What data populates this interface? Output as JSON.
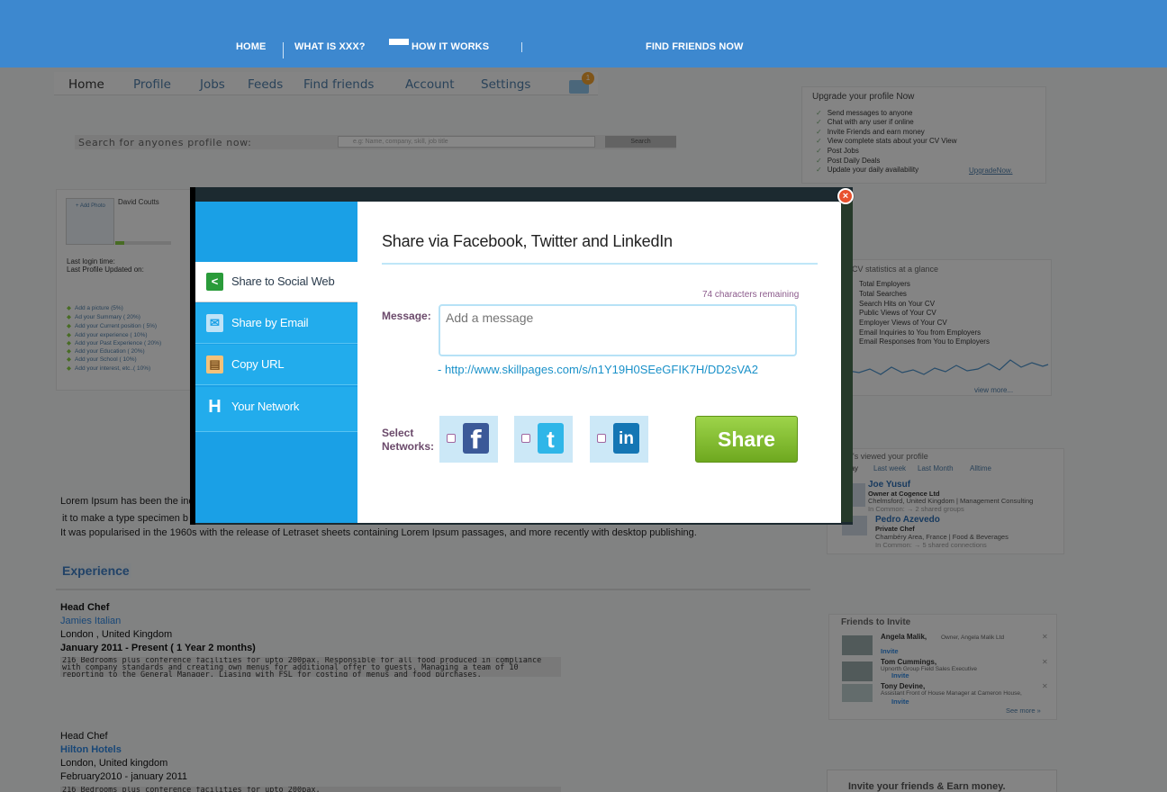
{
  "topnav": {
    "home": "HOME",
    "what_is": "WHAT IS XXX?",
    "how_it_works": "HOW IT WORKS",
    "find_friends": "FIND FRIENDS NOW"
  },
  "subnav": {
    "items": [
      "Home",
      "Profile",
      "Jobs",
      "Feeds",
      "Find friends",
      "Account",
      "Settings"
    ],
    "mail_badge": "1"
  },
  "search": {
    "label": "Search for anyones profile now:",
    "placeholder": "e.g: Name, company, skill, job title",
    "button": "Search"
  },
  "upgrade": {
    "title": "Upgrade your profile Now",
    "items": [
      "Send messages to anyone",
      "Chat with any user if online",
      "Invite Friends and earn money",
      "View complete stats about your CV View",
      "Post Jobs",
      "Post Daily Deals",
      "Update your daily availability"
    ],
    "link": "UpgradeNow."
  },
  "profile": {
    "add_photo": "+ Add Photo",
    "name": "David Coutts",
    "last_login": "Last login time:",
    "last_updated": "Last Profile Updated on:",
    "suggestions": [
      "Add a picture (5%)",
      "Ad your Summary ( 20%)",
      "Add your Current position ( 5%)",
      "Add your experience ( 10%)",
      "Add your Past Experience ( 20%)",
      "Add your Education ( 20%)",
      "Add your School ( 10%)",
      "Add your interest, etc..( 10%)"
    ]
  },
  "stats": {
    "title": "CV statistics at a glance",
    "items": [
      "Total Employers",
      "Total Searches",
      "Search Hits on Your CV",
      "Public Views of Your CV",
      "Employer Views of Your CV",
      "Email Inquiries to You from Employers",
      "Email Responses from You to Employers"
    ],
    "view_more": "view more..."
  },
  "viewed": {
    "title": "o's viewed your profile",
    "tabs": [
      "day",
      "Last week",
      "Last Month",
      "Alltime"
    ],
    "viewers": [
      {
        "name": "Joe Yusuf",
        "role": "Owner at Cogence Ltd",
        "loc": "Chelmsford, United Kingdom | Management Consulting",
        "common": "In Common:  → 2 shared groups"
      },
      {
        "name": "Pedro Azevedo",
        "role": "Private Chef",
        "loc": "Chambéry Area, France | Food & Beverages",
        "common": "In Common:  → 5 shared connections"
      }
    ]
  },
  "lorem": {
    "line1": "Lorem Ipsum has been the ind",
    "line2": "it to make a type specimen b",
    "line3": "It was popularised in the 1960s with the release of Letraset sheets containing Lorem Ipsum passages, and more recently with desktop publishing."
  },
  "experience": {
    "title": "Experience",
    "jobs": [
      {
        "title": "Head Chef",
        "company": "Jamies Italian",
        "location": "London , United Kingdom",
        "dates": "January 2011 - Present ( 1 Year 2 months)",
        "desc": "216 Bedrooms plus conference facilities for upto 200pax. Responsible for all food produced in compliance with company standards and creating own menus for additional offer to guests. Managing a team of 10 reporting to the General Manager. Liasing with FSL for costing of menus and food purchases."
      },
      {
        "title": "Head Chef",
        "company": "Hilton Hotels",
        "location": "London, United kingdom",
        "dates": "February2010 - january 2011",
        "desc": "216 Bedrooms plus conference facilities for upto 200pax."
      }
    ]
  },
  "friends": {
    "title": "Friends to Invite",
    "items": [
      {
        "name": "Angela Malik,",
        "role": "Owner, Angela Malik Ltd",
        "invite": "Invite"
      },
      {
        "name": "Tom Cummings,",
        "role": "Upnorth Group Field Sales Executive",
        "invite": "Invite"
      },
      {
        "name": "Tony Devine,",
        "role": "Assistant Front of House Manager at Cameron House,",
        "invite": "Invite"
      }
    ],
    "see_more": "See more »"
  },
  "invite_box": {
    "title": "Invite your friends & Earn money."
  },
  "modal": {
    "close": "×",
    "sidebar": [
      {
        "label": "Share to Social Web",
        "icon": "share-icon"
      },
      {
        "label": "Share by Email",
        "icon": "email-icon"
      },
      {
        "label": "Copy URL",
        "icon": "clipboard-icon"
      },
      {
        "label": "Your Network",
        "icon": "network-h-icon"
      }
    ],
    "title": "Share via Facebook, Twitter and LinkedIn",
    "chars_remaining": "74 characters remaining",
    "message_label": "Message:",
    "message_placeholder": "Add a message",
    "link": "- http://www.skillpages.com/s/n1Y19H0SEeGFIK7H/DD2sVA2",
    "select_label": "Select Networks:",
    "networks": [
      {
        "name": "facebook",
        "glyph": "f"
      },
      {
        "name": "twitter",
        "glyph": "t"
      },
      {
        "name": "linkedin",
        "glyph": "in"
      }
    ],
    "share_button": "Share"
  },
  "colors": {
    "topbar": "#3d88cf",
    "sidebar": "#1aa0e6",
    "share_green": "#7cb92c",
    "facebook": "#3b5998",
    "twitter": "#2fb6e8",
    "linkedin": "#1476b4"
  }
}
